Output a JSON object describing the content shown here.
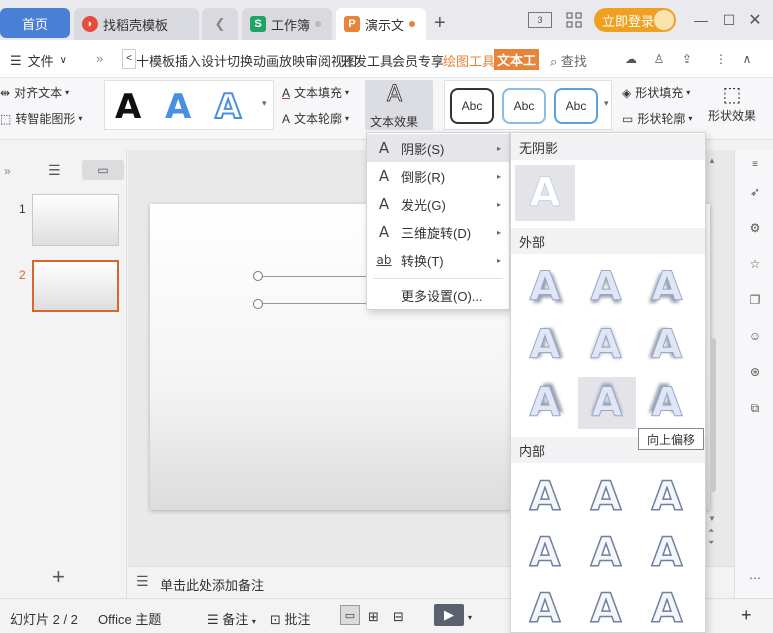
{
  "titlebar": {
    "tabs": [
      {
        "label": "首页",
        "icon": "home"
      },
      {
        "label": "找稻壳模板",
        "icon": "docer-icon"
      },
      {
        "label": "工作簿",
        "icon": "sheet-icon"
      },
      {
        "label": "演示文",
        "icon": "ppt-icon"
      }
    ],
    "login_label": "立即登录",
    "colors": {
      "home_tab": "#4a7fd6",
      "docer": "#e84b3c",
      "sheet": "#1fa463",
      "ppt": "#e8833a",
      "login": "#f0a020"
    }
  },
  "menu": {
    "file_label": "文件",
    "items_text": "十模板插入设计切换动画放映审阅视图",
    "dev_tools": "开发工具",
    "member": "会员专享",
    "draw_tools": "绘图工具",
    "text_tools": "文本工",
    "search_label": "查找"
  },
  "ribbon": {
    "align_text": "对齐文本",
    "smart_shape": "转智能图形",
    "text_fill": "文本填充",
    "text_outline": "文本轮廓",
    "text_effect": "文本效果",
    "abc": "Abc",
    "shape_fill": "形状填充",
    "shape_outline": "形状轮廓",
    "shape_effect": "形状效果"
  },
  "slides_panel": {
    "numbers": [
      "1",
      "2"
    ],
    "active": "2"
  },
  "effect_menu": {
    "items": [
      {
        "label": "阴影(S)",
        "glyph": "A",
        "has_sub": true
      },
      {
        "label": "倒影(R)",
        "glyph": "A",
        "has_sub": true
      },
      {
        "label": "发光(G)",
        "glyph": "A",
        "has_sub": true
      },
      {
        "label": "三维旋转(D)",
        "glyph": "A",
        "has_sub": true
      },
      {
        "label": "转换(T)",
        "glyph": "ab",
        "has_sub": true
      }
    ],
    "more": "更多设置(O)..."
  },
  "shadow_panel": {
    "no_shadow": "无阴影",
    "outer": "外部",
    "inner": "内部",
    "glyph": "A",
    "tooltip": "向上偏移"
  },
  "notes": {
    "placeholder": "单击此处添加备注"
  },
  "statusbar": {
    "slide_count": "幻灯片 2 / 2",
    "theme": "Office 主题",
    "notes": "备注",
    "comment": "批注"
  }
}
